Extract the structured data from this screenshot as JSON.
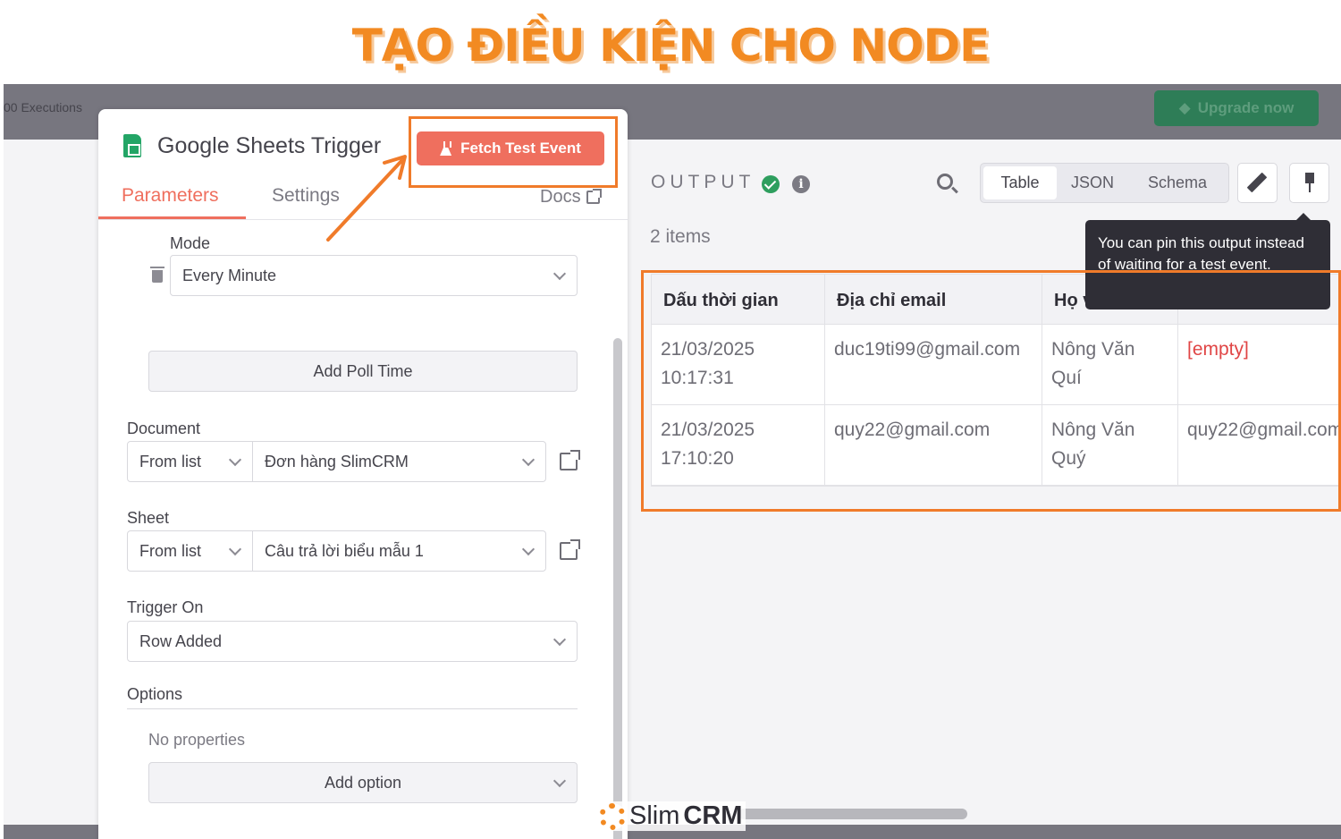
{
  "headline": "TẠO ĐIỀU KIỆN CHO NODE",
  "topbar": {
    "executions": "00 Executions",
    "upgrade_label": "Upgrade now"
  },
  "node": {
    "title": "Google Sheets Trigger",
    "fetch_label": "Fetch Test Event",
    "tabs": {
      "parameters": "Parameters",
      "settings": "Settings",
      "docs": "Docs"
    }
  },
  "fields": {
    "mode": {
      "label": "Mode",
      "value": "Every Minute"
    },
    "add_poll_time": "Add Poll Time",
    "document": {
      "label": "Document",
      "mode": "From list",
      "value": "Đơn hàng SlimCRM"
    },
    "sheet": {
      "label": "Sheet",
      "mode": "From list",
      "value": "Câu trả lời biểu mẫu 1"
    },
    "trigger_on": {
      "label": "Trigger On",
      "value": "Row Added"
    },
    "options": {
      "label": "Options",
      "empty_text": "No properties",
      "add_option": "Add option"
    }
  },
  "output": {
    "label": "OUTPUT",
    "items_count": "2 items",
    "views": [
      "Table",
      "JSON",
      "Schema"
    ],
    "tooltip": "You can pin this output instead of waiting for a test event.",
    "columns": [
      "Dấu thời gian",
      "Địa chỉ email",
      "Họ và tên",
      ""
    ],
    "rows": [
      {
        "timestamp_date": "21/03/2025",
        "timestamp_time": "10:17:31",
        "email": "duc19ti99@gmail.com",
        "name_line1": "Nông Văn",
        "name_line2": "Quí",
        "extra": "[empty]"
      },
      {
        "timestamp_date": "21/03/2025",
        "timestamp_time": "17:10:20",
        "email": "quy22@gmail.com",
        "name_line1": "Nông Văn",
        "name_line2": "Quý",
        "extra": "quy22@gmail.com"
      }
    ]
  },
  "brand": {
    "slim": "Slim",
    "crm": "CRM"
  },
  "colors": {
    "accent": "#ef6f5e",
    "annotation": "#f07b2a",
    "success": "#2e9e5e",
    "headline": "#f28a22"
  }
}
